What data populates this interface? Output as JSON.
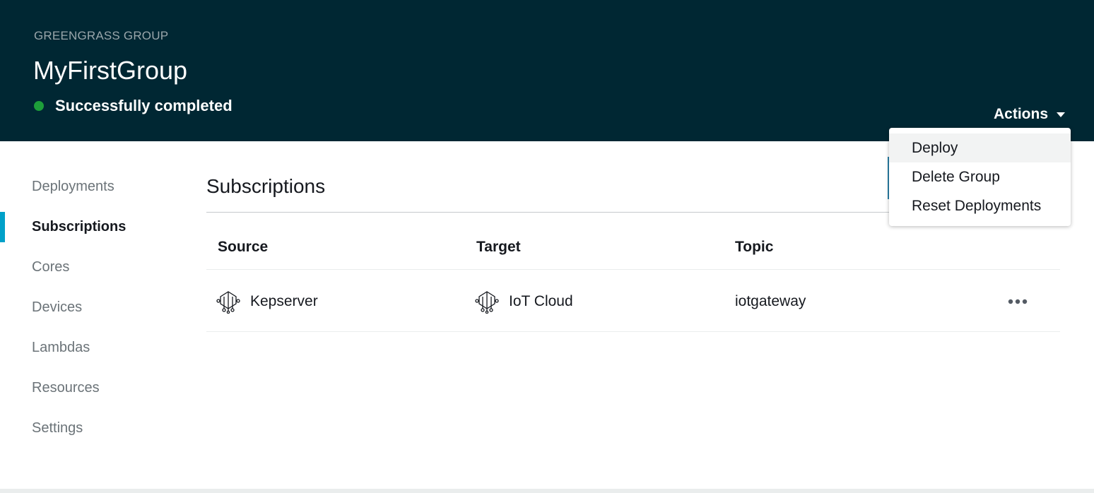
{
  "header": {
    "eyebrow": "GREENGRASS GROUP",
    "title": "MyFirstGroup",
    "status_text": "Successfully completed",
    "status_color": "#1d9e3a",
    "actions_label": "Actions",
    "background": "#002733"
  },
  "sidebar": {
    "items": [
      {
        "label": "Deployments",
        "active": false
      },
      {
        "label": "Subscriptions",
        "active": true
      },
      {
        "label": "Cores",
        "active": false
      },
      {
        "label": "Devices",
        "active": false
      },
      {
        "label": "Lambdas",
        "active": false
      },
      {
        "label": "Resources",
        "active": false
      },
      {
        "label": "Settings",
        "active": false
      }
    ],
    "accent_color": "#00a1c9"
  },
  "main": {
    "section_title": "Subscriptions",
    "table": {
      "columns": [
        "Source",
        "Target",
        "Topic"
      ],
      "rows": [
        {
          "source": "Kepserver",
          "source_icon": "device-icon",
          "target": "IoT Cloud",
          "target_icon": "device-icon",
          "topic": "iotgateway",
          "menu_icon": "more-icon"
        }
      ]
    }
  },
  "actions_menu": {
    "items": [
      {
        "label": "Deploy",
        "highlighted": true
      },
      {
        "label": "Delete Group",
        "highlighted": false
      },
      {
        "label": "Reset Deployments",
        "highlighted": false
      }
    ]
  }
}
